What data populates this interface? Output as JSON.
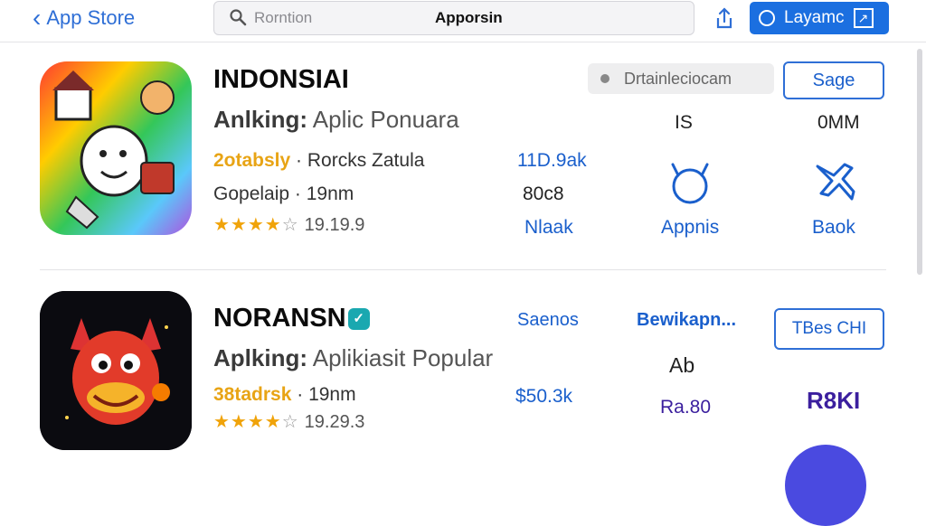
{
  "header": {
    "back_label": "App Store",
    "search_placeholder": "Rorntion",
    "search_value": "Apporsin",
    "layout_button": "Layamc"
  },
  "apps": [
    {
      "title": "INDONSIAI",
      "subtitle_bold": "Anlking:",
      "subtitle_rest": " Aplic Ponuara",
      "tag": "2otabsly",
      "category": "Rorcks Zatula",
      "size": "Gopelaip · 19nm",
      "rating_value": 4.5,
      "rating_text": "19.19.9",
      "status_pill": "Drtainleciocam",
      "action_button": "Sage",
      "col1": [
        "11D.9ak",
        "80c8",
        "Nlaak"
      ],
      "col2": [
        "IS",
        "Appnis"
      ],
      "col3": [
        "0MM",
        "Baok"
      ]
    },
    {
      "title": "NORANSN",
      "subtitle_bold": "Aplking:",
      "subtitle_rest": " Aplikiasit Popular",
      "tag": "38tadrsk",
      "size": "19nm",
      "rating_value": 4.5,
      "rating_text": "19.29.3",
      "col1": [
        "Saenos",
        "$50.3k"
      ],
      "col2": [
        "Bewikapn...",
        "Ab",
        "Ra.80"
      ],
      "action_button": "TBes CHI",
      "col3": [
        "R8KI"
      ]
    }
  ],
  "colors": {
    "accent": "#1b6fe0",
    "link": "#1a5fcc",
    "star": "#f0a30a",
    "rating_tag": "#e8a415",
    "purple_value": "#3b1f9e"
  },
  "icons": [
    "chevron-left-icon",
    "search-icon",
    "share-icon",
    "info-circle-icon",
    "expand-icon",
    "pet-face-icon",
    "plane-icon",
    "app-icon"
  ]
}
